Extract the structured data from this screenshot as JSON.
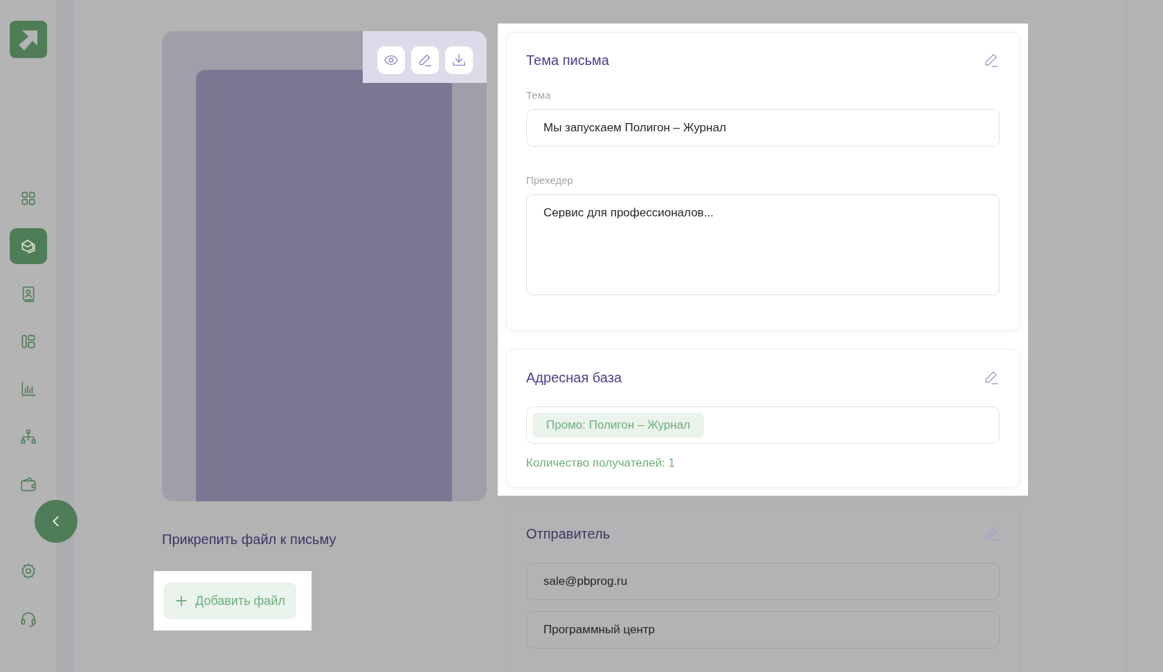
{
  "sidebar": {
    "items": [
      {
        "selected": false
      },
      {
        "selected": true
      },
      {
        "selected": false
      },
      {
        "selected": false
      },
      {
        "selected": false
      },
      {
        "selected": false
      },
      {
        "selected": false
      }
    ]
  },
  "attach": {
    "title": "Прикрепить файл к письму",
    "button": "Добавить файл"
  },
  "cards": [
    {
      "kind": "subject",
      "highlighted": true,
      "title": "Тема письма",
      "fields": [
        {
          "kind": "line",
          "label": "Тема",
          "value": "Мы запускаем Полигон – Журнал"
        },
        {
          "kind": "area",
          "label": "Прехедер",
          "value": "Сервис для профессионалов..."
        }
      ]
    },
    {
      "kind": "audience",
      "highlighted": true,
      "title": "Адресная база",
      "tags": [
        "Промо: Полигон – Журнал"
      ],
      "note": "Количество получателей: 1"
    },
    {
      "kind": "sender",
      "highlighted": false,
      "title": "Отправитель",
      "fields": [
        {
          "kind": "line",
          "value": "sale@pbprog.ru"
        },
        {
          "kind": "line",
          "value": "Программный центр"
        }
      ]
    }
  ]
}
